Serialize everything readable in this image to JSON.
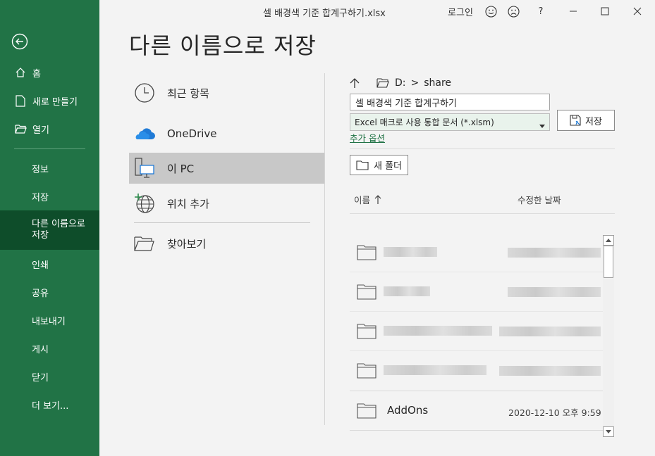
{
  "window": {
    "title": "셀 배경색 기준 합계구하기.xlsx",
    "signin_label": "로그인",
    "smile_icon": "smile-icon",
    "frown_icon": "frown-icon",
    "help_label": "?"
  },
  "sidebar": {
    "back_icon": "back-arrow-icon",
    "items": [
      {
        "label": "홈",
        "icon": "home-icon"
      },
      {
        "label": "새로 만들기",
        "icon": "new-document-icon"
      },
      {
        "label": "열기",
        "icon": "open-folder-icon"
      },
      {
        "label": "정보"
      },
      {
        "label": "저장"
      },
      {
        "label": "다른 이름으로\n저장",
        "active": true
      },
      {
        "label": "인쇄"
      },
      {
        "label": "공유"
      },
      {
        "label": "내보내기"
      },
      {
        "label": "게시"
      },
      {
        "label": "닫기"
      },
      {
        "label": "더 보기..."
      }
    ]
  },
  "page": {
    "title": "다른 이름으로 저장"
  },
  "locations": [
    {
      "label": "최근 항목",
      "icon": "clock-icon"
    },
    {
      "label": "OneDrive",
      "icon": "onedrive-cloud-icon"
    },
    {
      "label": "이 PC",
      "icon": "this-pc-icon",
      "active": true
    },
    {
      "label": "위치 추가",
      "icon": "add-place-globe-icon"
    },
    {
      "label": "찾아보기",
      "icon": "browse-folder-icon"
    }
  ],
  "save_panel": {
    "path": {
      "drive": "D:",
      "separator": ">",
      "folder": "share"
    },
    "filename": "셀 배경색 기준 합계구하기",
    "filetype": "Excel 매크로 사용 통합 문서 (*.xlsm)",
    "save_label": "저장",
    "more_options": "추가 옵션",
    "new_folder_label": "새 폴더",
    "columns": {
      "name": "이름",
      "date": "수정한 날짜"
    },
    "files": [
      {
        "name": "",
        "date": "",
        "blurred": true
      },
      {
        "name": "",
        "date": "",
        "blurred": true
      },
      {
        "name": "",
        "date": "",
        "blurred": true
      },
      {
        "name": "",
        "date": "",
        "blurred": true
      },
      {
        "name": "AddOns",
        "date": "2020-12-10 오후 9:59"
      }
    ]
  },
  "colors": {
    "sidebar": "#217346",
    "sidebar_active": "#0e4d2a",
    "accent": "#217346"
  }
}
